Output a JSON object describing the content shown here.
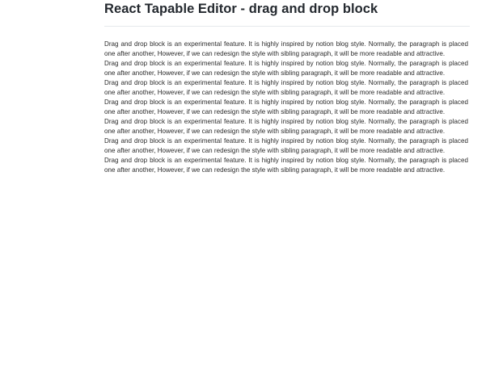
{
  "header": {
    "title": "React Tapable Editor - drag and drop block"
  },
  "editor": {
    "blocks": [
      "Drag and drop block is an experimental feature. It is highly inspired by notion blog style. Normally, the paragraph is placed one after another, However, if we can redesign the style with sibling paragraph, it will be more readable and attractive.",
      "Drag and drop block is an experimental feature. It is highly inspired by notion blog style. Normally, the paragraph is placed one after another, However, if we can redesign the style with sibling paragraph, it will be more readable and attractive.",
      "Drag and drop block is an experimental feature. It is highly inspired by notion blog style. Normally, the paragraph is placed one after another, However, if we can redesign the style with sibling paragraph, it will be more readable and attractive.",
      "Drag and drop block is an experimental feature. It is highly inspired by notion blog style. Normally, the paragraph is placed one after another, However, if we can redesign the style with sibling paragraph, it will be more readable and attractive.",
      "Drag and drop block is an experimental feature. It is highly inspired by notion blog style. Normally, the paragraph is placed one after another, However, if we can redesign the style with sibling paragraph, it will be more readable and attractive.",
      "Drag and drop block is an experimental feature. It is highly inspired by notion blog style. Normally, the paragraph is placed one after another, However, if we can redesign the style with sibling paragraph, it will be more readable and attractive.",
      "Drag and drop block is an experimental feature. It is highly inspired by notion blog style. Normally, the paragraph is placed one after another, However, if we can redesign the style with sibling paragraph, it will be more readable and attractive."
    ]
  }
}
